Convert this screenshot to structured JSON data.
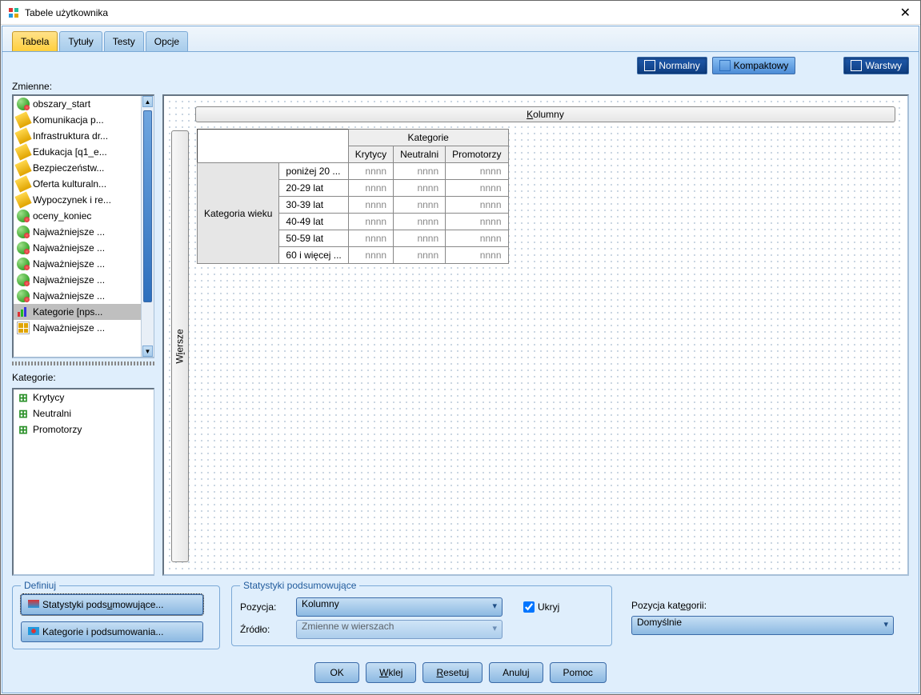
{
  "window": {
    "title": "Tabele użytkownika"
  },
  "tabs": {
    "tabela": "Tabela",
    "tytuly": "Tytuły",
    "testy": "Testy",
    "opcje": "Opcje"
  },
  "zmienne_label": "Zmienne:",
  "view": {
    "normalny": "Normalny",
    "kompaktowy": "Kompaktowy",
    "warstwy": "Warstwy"
  },
  "variables": [
    {
      "icon": "nominal",
      "label": "obszary_start"
    },
    {
      "icon": "scale",
      "label": "Komunikacja p..."
    },
    {
      "icon": "scale",
      "label": "Infrastruktura dr..."
    },
    {
      "icon": "scale",
      "label": "Edukacja [q1_e..."
    },
    {
      "icon": "scale",
      "label": "Bezpieczeństw..."
    },
    {
      "icon": "scale",
      "label": "Oferta kulturaln..."
    },
    {
      "icon": "scale",
      "label": "Wypoczynek i re..."
    },
    {
      "icon": "nominal",
      "label": "oceny_koniec"
    },
    {
      "icon": "nominal",
      "label": "Najważniejsze ..."
    },
    {
      "icon": "nominal",
      "label": "Najważniejsze ..."
    },
    {
      "icon": "nominal",
      "label": "Najważniejsze ..."
    },
    {
      "icon": "nominal",
      "label": "Najważniejsze ..."
    },
    {
      "icon": "nominal",
      "label": "Najważniejsze ..."
    },
    {
      "icon": "ordinal",
      "label": "Kategorie [nps...",
      "selected": true
    },
    {
      "icon": "set",
      "label": "Najważniejsze ..."
    }
  ],
  "kategorie_label": "Kategorie:",
  "kategorie": [
    {
      "label": "Krytycy"
    },
    {
      "label": "Neutralni"
    },
    {
      "label": "Promotorzy"
    }
  ],
  "canvas": {
    "kolumny": "Kolumny",
    "wiersze": "Wiersze",
    "kategorie_header": "Kategorie",
    "col_categories": [
      "Krytycy",
      "Neutralni",
      "Promotorzy"
    ],
    "row_var": "Kategoria wieku",
    "row_categories": [
      "poniżej 20 ...",
      "20-29 lat",
      "30-39 lat",
      "40-49 lat",
      "50-59 lat",
      "60 i więcej ..."
    ],
    "placeholder": "nnnn"
  },
  "definiuj": {
    "legend": "Definiuj",
    "stat_btn": "Statystyki podsumowujące...",
    "kat_btn": "Kategorie i podsumowania..."
  },
  "stats": {
    "legend": "Statystyki podsumowujące",
    "pozycja_label": "Pozycja:",
    "pozycja_value": "Kolumny",
    "zrodlo_label": "Źródło:",
    "zrodlo_value": "Zmienne w wierszach",
    "ukryj": "Ukryj"
  },
  "pozkat": {
    "label": "Pozycja kategorii:",
    "value": "Domyślnie"
  },
  "dlg": {
    "ok": "OK",
    "wklej": "Wklej",
    "reset": "Resetuj",
    "anuluj": "Anuluj",
    "pomoc": "Pomoc"
  }
}
